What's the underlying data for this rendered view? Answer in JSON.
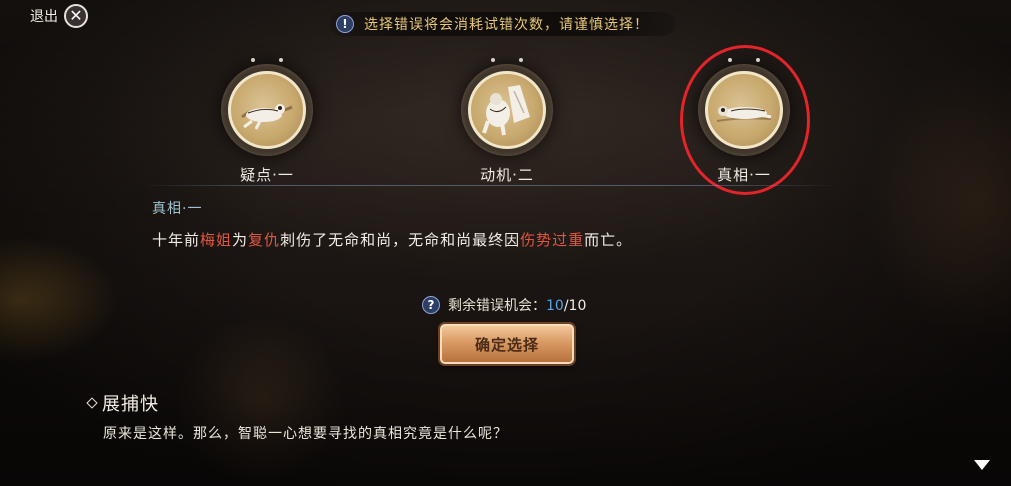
{
  "top": {
    "exit_label": "退出",
    "warning": "选择错误将会消耗试错次数，请谨慎选择！"
  },
  "clues": [
    {
      "label": "疑点·一",
      "icon": "collapsed-figure-icon"
    },
    {
      "label": "动机·二",
      "icon": "fallen-monk-icon"
    },
    {
      "label": "真相·一",
      "icon": "lying-body-icon"
    }
  ],
  "selected_index": 2,
  "detail": {
    "title": "真相·一",
    "segments": [
      {
        "text": "十年前",
        "highlight": false
      },
      {
        "text": "梅姐",
        "highlight": true
      },
      {
        "text": "为",
        "highlight": false
      },
      {
        "text": "复仇",
        "highlight": true
      },
      {
        "text": "刺伤了无命和尚，无命和尚最终因",
        "highlight": false
      },
      {
        "text": "伤势过重",
        "highlight": true
      },
      {
        "text": "而亡。",
        "highlight": false
      }
    ]
  },
  "attempts": {
    "label": "剩余错误机会：",
    "current": "10",
    "separator": "/",
    "max": "10"
  },
  "confirm_label": "确定选择",
  "dialog": {
    "speaker": "展捕快",
    "text": "原来是这样。那么，智聪一心想要寻找的真相究竟是什么呢？"
  },
  "colors": {
    "highlight": "#e0573f",
    "selection_ring": "#e3242b",
    "attempts_current": "#57a6e6",
    "warning_text": "#e8c777"
  }
}
